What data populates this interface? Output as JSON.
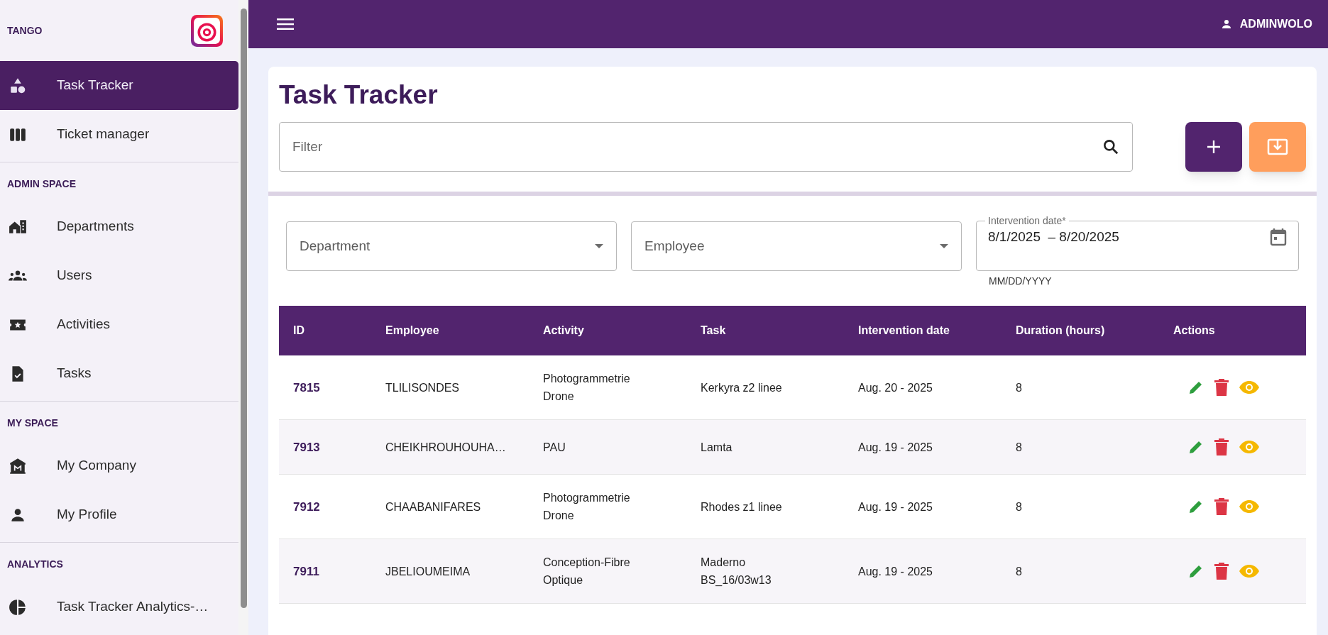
{
  "sidebar": {
    "brand": "TANGO",
    "sections": [
      {
        "items": [
          {
            "label": "Task Tracker",
            "selected": true
          },
          {
            "label": "Ticket manager",
            "selected": false
          }
        ]
      },
      {
        "title": "ADMIN SPACE",
        "items": [
          {
            "label": "Departments",
            "selected": false
          },
          {
            "label": "Users",
            "selected": false
          },
          {
            "label": "Activities",
            "selected": false
          },
          {
            "label": "Tasks",
            "selected": false
          }
        ]
      },
      {
        "title": "MY SPACE",
        "items": [
          {
            "label": "My Company",
            "selected": false
          },
          {
            "label": "My Profile",
            "selected": false
          }
        ]
      },
      {
        "title": "ANALYTICS",
        "items": [
          {
            "label": "Task Tracker Analytics-…",
            "selected": false
          }
        ]
      }
    ]
  },
  "header": {
    "user": "ADMINWOLO"
  },
  "page": {
    "title": "Task Tracker",
    "filter": {
      "placeholder": "Filter"
    },
    "selects": [
      {
        "placeholder": "Department"
      },
      {
        "placeholder": "Employee"
      }
    ],
    "date_range": {
      "label": "Intervention date*",
      "value": "8/1/2025  – 8/20/2025",
      "helper": "MM/DD/YYYY"
    }
  },
  "table": {
    "columns": [
      "ID",
      "Employee",
      "Activity",
      "Task",
      "Intervention date",
      "Duration (hours)",
      "Actions"
    ],
    "rows": [
      {
        "id": "7815",
        "employee": "TLILISONDES",
        "activity": "Photogrammetrie Drone",
        "task": "Kerkyra z2 linee",
        "date": "Aug. 20 - 2025",
        "duration": "8"
      },
      {
        "id": "7913",
        "employee": "CHEIKHROUHOUHA…",
        "activity": "PAU",
        "task": "Lamta",
        "date": "Aug. 19 - 2025",
        "duration": "8"
      },
      {
        "id": "7912",
        "employee": "CHAABANIFARES",
        "activity": "Photogrammetrie Drone",
        "task": "Rhodes z1 linee",
        "date": "Aug. 19 - 2025",
        "duration": "8"
      },
      {
        "id": "7911",
        "employee": "JBELIOUMEIMA",
        "activity": "Conception-Fibre Optique",
        "task": "Maderno BS_16/03w13",
        "date": "Aug. 19 - 2025",
        "duration": "8"
      }
    ]
  }
}
